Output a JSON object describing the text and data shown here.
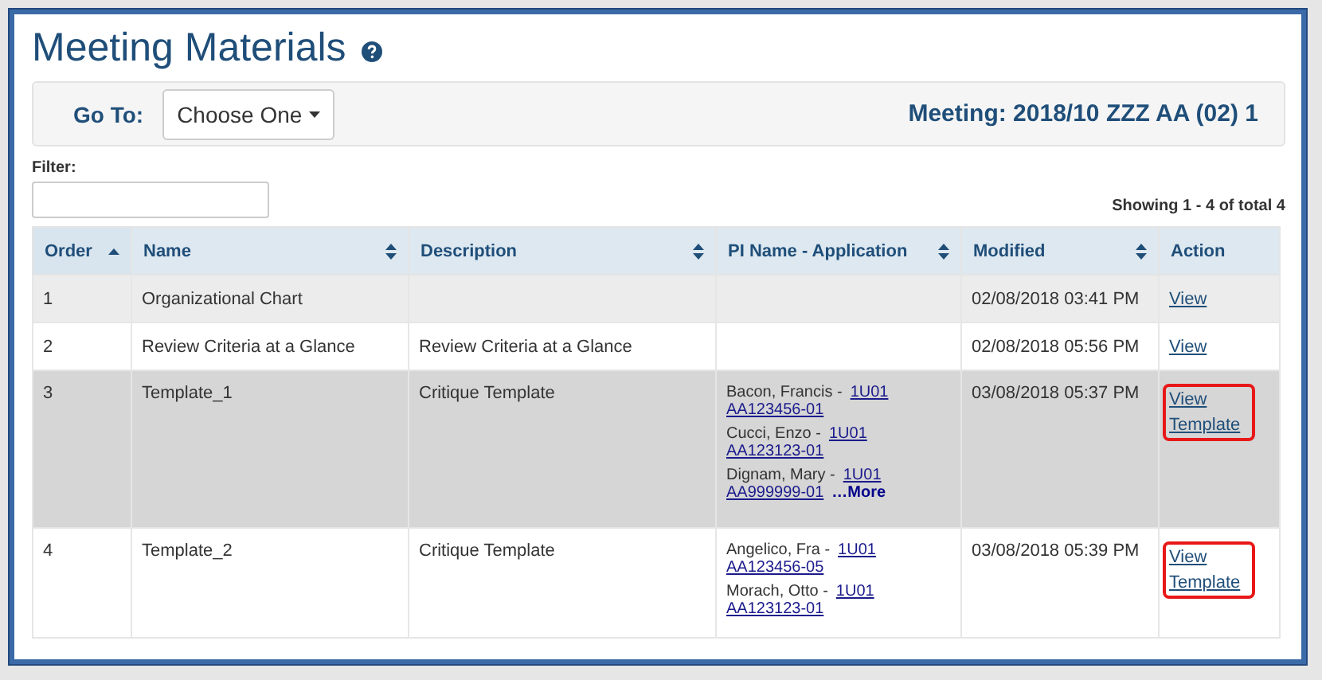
{
  "title": "Meeting Materials",
  "toolbar": {
    "goto_label": "Go To:",
    "dropdown": "Choose One",
    "meeting": "Meeting: 2018/10 ZZZ AA (02) 1"
  },
  "filter": {
    "label": "Filter:"
  },
  "showing": "Showing 1 - 4 of total 4",
  "columns": [
    {
      "label": "Order",
      "sortable": true,
      "sorted": true
    },
    {
      "label": "Name",
      "sortable": true,
      "sorted": false
    },
    {
      "label": "Description",
      "sortable": true,
      "sorted": false
    },
    {
      "label": "PI Name - Application",
      "sortable": true,
      "sorted": false
    },
    {
      "label": "Modified",
      "sortable": true,
      "sorted": false
    },
    {
      "label": "Action",
      "sortable": false,
      "sorted": false
    }
  ],
  "rows": [
    {
      "order": "1",
      "name": "Organizational Chart",
      "description": "",
      "pis": [],
      "modified": "02/08/2018 03:41 PM",
      "action": "View",
      "selected": false,
      "highlighted": false
    },
    {
      "order": "2",
      "name": "Review Criteria at a Glance",
      "description": "Review Criteria at a Glance",
      "pis": [],
      "modified": "02/08/2018 05:56 PM",
      "action": "View",
      "selected": false,
      "highlighted": false
    },
    {
      "order": "3",
      "name": "Template_1",
      "description": "Critique Template",
      "pis": [
        {
          "name": "Bacon, Francis -",
          "code": "1U01",
          "number": "AA123456-01"
        },
        {
          "name": "Cucci, Enzo -",
          "code": "1U01",
          "number": "AA123123-01"
        },
        {
          "name": "Dignam, Mary -",
          "code": "1U01",
          "number": "AA999999-01"
        }
      ],
      "more": "…More",
      "modified": "03/08/2018 05:37 PM",
      "action": "View Template",
      "selected": true,
      "highlighted": true
    },
    {
      "order": "4",
      "name": "Template_2",
      "description": "Critique Template",
      "pis": [
        {
          "name": "Angelico, Fra -",
          "code": "1U01",
          "number": "AA123456-05"
        },
        {
          "name": "Morach, Otto -",
          "code": "1U01",
          "number": "AA123123-01"
        }
      ],
      "modified": "03/08/2018 05:39 PM",
      "action": "View Template",
      "selected": false,
      "highlighted": true
    }
  ]
}
